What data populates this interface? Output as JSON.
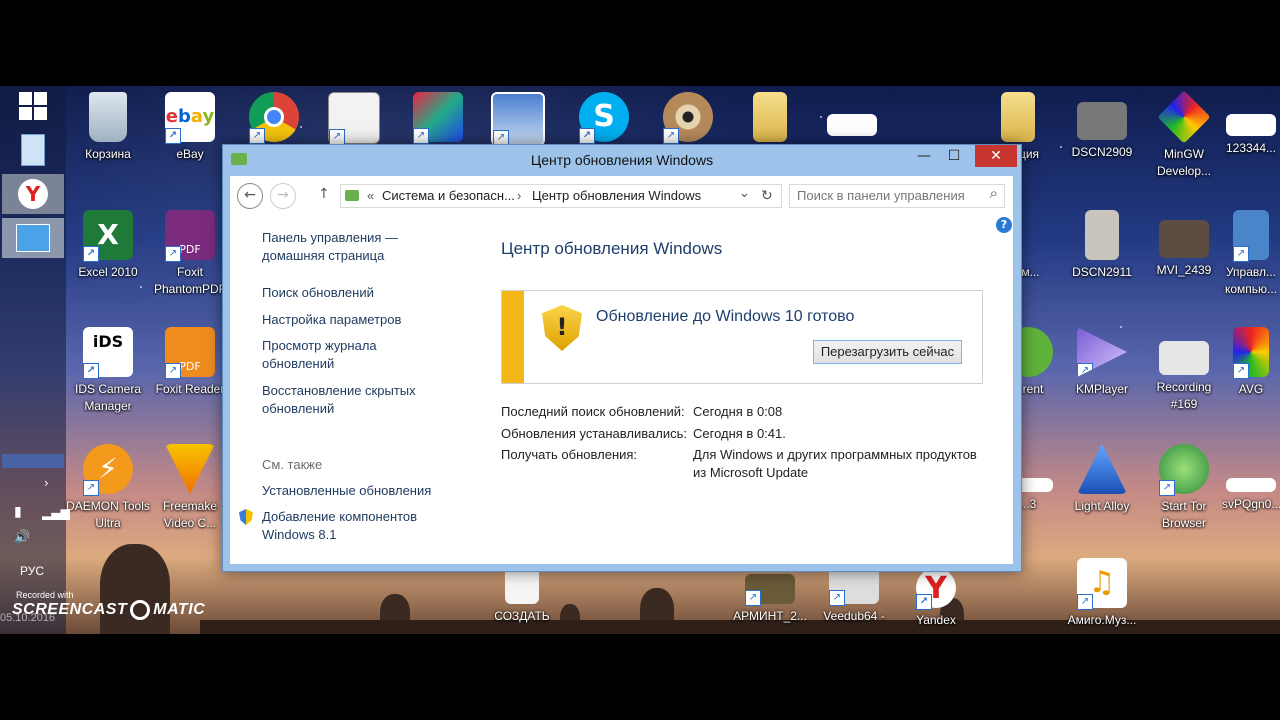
{
  "desktop": {
    "icons": [
      {
        "label": "Корзина"
      },
      {
        "label": "eBay"
      },
      {
        "label": ""
      },
      {
        "label": ""
      },
      {
        "label": ""
      },
      {
        "label": ""
      },
      {
        "label": ""
      },
      {
        "label": ""
      },
      {
        "label": ""
      },
      {
        "label": ""
      },
      {
        "label": "...тация"
      },
      {
        "label": "DSCN2909"
      },
      {
        "label": "MinGW Develop..."
      },
      {
        "label": "123344..."
      },
      {
        "label": "Excel 2010"
      },
      {
        "label": "Foxit PhantomPDF"
      },
      {
        "label": "...амм..."
      },
      {
        "label": "DSCN2911"
      },
      {
        "label": "MVI_2439"
      },
      {
        "label": "Управл... компью..."
      },
      {
        "label": "IDS Camera Manager"
      },
      {
        "label": "Foxit Reader"
      },
      {
        "label": "...rent"
      },
      {
        "label": "KMPlayer"
      },
      {
        "label": "Recording #169"
      },
      {
        "label": "AVG"
      },
      {
        "label": "DAEMON Tools Ultra"
      },
      {
        "label": "Freemake Video C..."
      },
      {
        "label": "...3"
      },
      {
        "label": "Light Alloy"
      },
      {
        "label": "Start Tor Browser"
      },
      {
        "label": "svPQgn0..."
      },
      {
        "label": "СОЗДАТЬ"
      },
      {
        "label": "АРМИНТ_2..."
      },
      {
        "label": "Veedub64 -"
      },
      {
        "label": "Yandex"
      },
      {
        "label": "Амиго.Муз..."
      }
    ]
  },
  "leftbar": {
    "lang": "РУС",
    "recorded_with": "Recorded with",
    "screencast": "SCREENCAST",
    "matic": "MATIC",
    "date": "05.10.2016"
  },
  "window": {
    "title": "Центр обновления Windows",
    "buttons": {
      "minimize": "—",
      "maximize": "☐",
      "close": "✕"
    },
    "nav": {
      "back": "←",
      "forward": "→",
      "up": "↑",
      "breadcrumb_prefix": "«",
      "crumb1": "Система и безопасн...",
      "sep": "›",
      "crumb2": "Центр обновления Windows",
      "dropdown": "⌄",
      "refresh": "↻",
      "search_placeholder": "Поиск в панели управления",
      "search_icon": "⌕",
      "help": "?"
    },
    "sidebar": {
      "home_link": "Панель управления — домашняя страница",
      "links": [
        "Поиск обновлений",
        "Настройка параметров",
        "Просмотр журнала обновлений",
        "Восстановление скрытых обновлений"
      ],
      "see_also": "См. также",
      "see_also_links": [
        "Установленные обновления",
        "Добавление компонентов Windows 8.1"
      ]
    },
    "main": {
      "heading": "Центр обновления Windows",
      "update_box": {
        "text": "Обновление до Windows 10 готово",
        "button": "Перезагрузить сейчас",
        "stripe_color": "#f3b818"
      },
      "info": [
        {
          "label": "Последний поиск обновлений:",
          "value": "Сегодня в 0:08"
        },
        {
          "label": "Обновления устанавливались:",
          "value": "Сегодня в 0:41."
        },
        {
          "label": "Получать обновления:",
          "value": "Для Windows и других программных продуктов из Microsoft Update"
        }
      ]
    }
  }
}
